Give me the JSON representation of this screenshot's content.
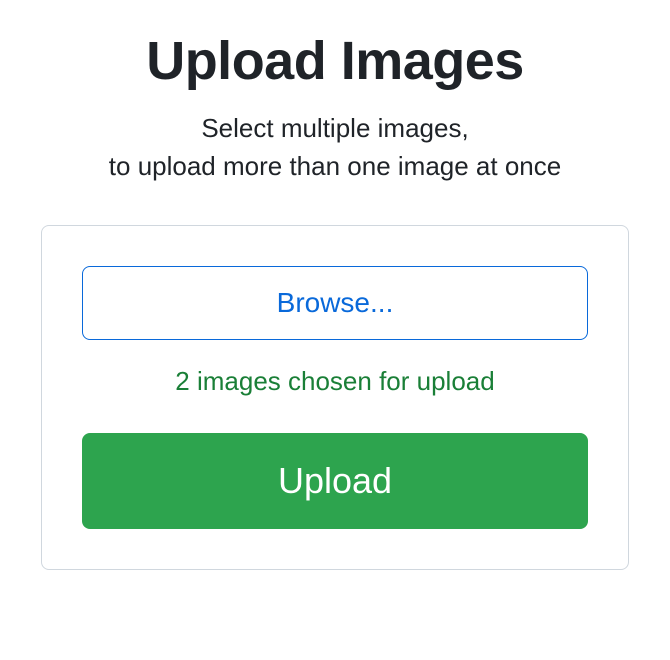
{
  "header": {
    "title": "Upload Images",
    "subtitle_line1": "Select multiple images,",
    "subtitle_line2": "to upload more than one image at once"
  },
  "uploader": {
    "browse_label": "Browse...",
    "status_message": "2 images chosen for upload",
    "upload_label": "Upload"
  }
}
